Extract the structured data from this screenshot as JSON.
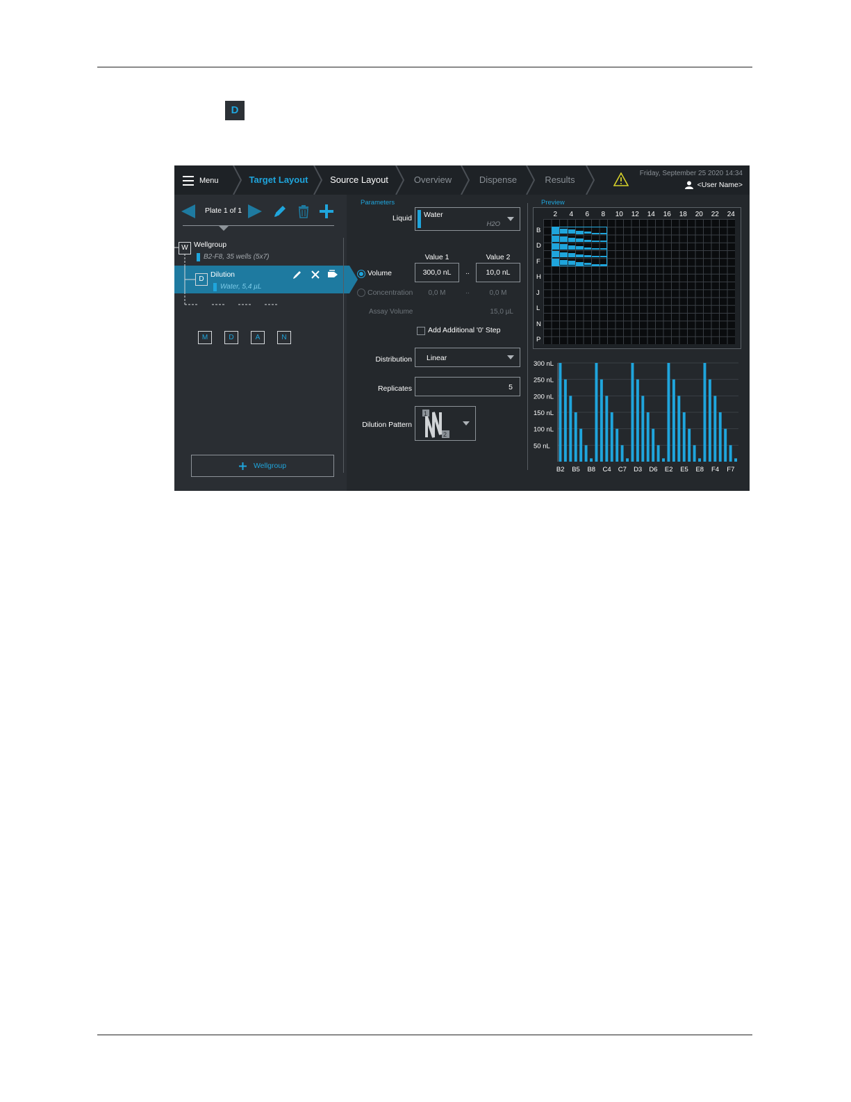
{
  "page": {
    "d_icon": "D"
  },
  "app": {
    "menu_label": "Menu",
    "tabs": [
      {
        "label": "Target Layout",
        "state": "active"
      },
      {
        "label": "Source Layout",
        "state": "done"
      },
      {
        "label": "Overview",
        "state": "pending"
      },
      {
        "label": "Dispense",
        "state": "pending"
      },
      {
        "label": "Results",
        "state": "pending"
      }
    ],
    "datetime": "Friday, September 25 2020  14:34",
    "user_name": "<User Name>",
    "colors": {
      "accent": "#1fa5dc",
      "selected_row": "#1e7aa0",
      "warning": "#d6d12a",
      "background": "#24282c"
    }
  },
  "left": {
    "plate_label": "Plate 1 of 1",
    "wellgroup": {
      "box": "W",
      "title": "Wellgroup",
      "sub": "B2-F8, 35 wells (5x7)"
    },
    "dilution": {
      "box": "D",
      "title": "Dilution",
      "sub": "Water, 5,4 µL"
    },
    "steps": [
      "M",
      "D",
      "A",
      "N"
    ],
    "add_wellgroup": "Wellgroup"
  },
  "params": {
    "section": "Parameters",
    "liquid_label": "Liquid",
    "liquid_value": "Water",
    "liquid_sub": "H2O",
    "value1_header": "Value 1",
    "value2_header": "Value 2",
    "volume_label": "Volume",
    "volume_v1": "300,0 nL",
    "volume_v2": "10,0 nL",
    "range_sep": "..",
    "concentration_label": "Concentration",
    "conc_v1": "0,0 M",
    "conc_v2": "0,0 M",
    "assay_label": "Assay Volume",
    "assay_value": "15,0 µL",
    "add_zero_label": "Add Additional '0' Step",
    "distribution_label": "Distribution",
    "distribution_value": "Linear",
    "replicates_label": "Replicates",
    "replicates_value": "5",
    "pattern_label": "Dilution Pattern"
  },
  "preview": {
    "label": "Preview",
    "col_labels": [
      "2",
      "4",
      "6",
      "8",
      "10",
      "12",
      "14",
      "16",
      "18",
      "20",
      "22",
      "24"
    ],
    "row_labels": [
      "B",
      "D",
      "F",
      "H",
      "J",
      "L",
      "N",
      "P"
    ],
    "filled_rows": 5,
    "filled_cols": 7,
    "well_levels": [
      1.0,
      0.83,
      0.67,
      0.5,
      0.33,
      0.17,
      0.03
    ]
  },
  "chart_data": {
    "type": "bar",
    "categories": [
      "B2",
      "B5",
      "B8",
      "C4",
      "C7",
      "D3",
      "D6",
      "E2",
      "E5",
      "E8",
      "F4",
      "F7"
    ],
    "values": [
      300,
      250,
      200,
      150,
      100,
      50,
      10,
      300,
      250,
      200,
      150,
      100,
      50,
      10,
      300,
      250,
      200,
      150,
      100,
      50,
      10,
      300,
      250,
      200,
      150,
      100,
      50,
      10,
      300,
      250,
      200,
      150,
      100,
      50,
      10
    ],
    "ytick_labels": [
      "300 nL",
      "250 nL",
      "200 nL",
      "150 nL",
      "100 nL",
      "50 nL"
    ],
    "yticks": [
      300,
      250,
      200,
      150,
      100,
      50
    ],
    "ylim": [
      0,
      300
    ],
    "grid": true,
    "color": "#1fa5dc"
  }
}
